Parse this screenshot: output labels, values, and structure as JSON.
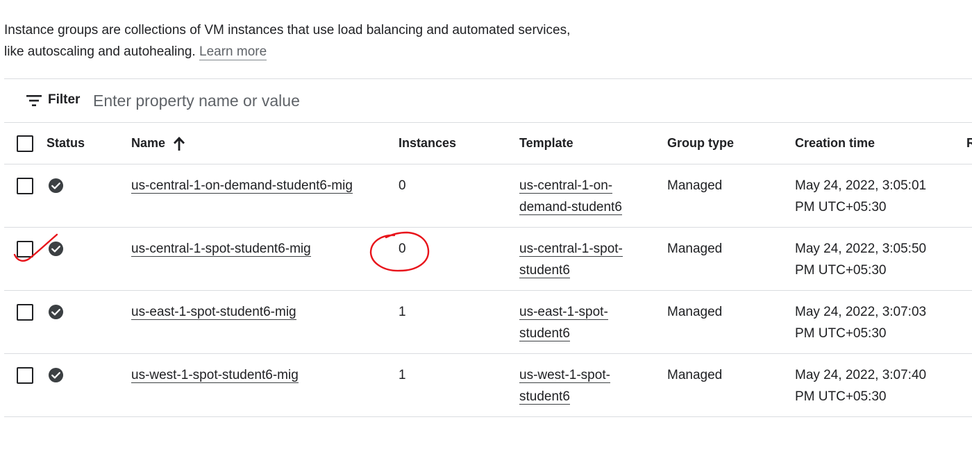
{
  "intro": {
    "text": "Instance groups are collections of VM instances that use load balancing and automated services, like autoscaling and autohealing.",
    "learn_more": "Learn more"
  },
  "filter": {
    "label": "Filter",
    "placeholder": "Enter property name or value",
    "icon": "filter-list-icon"
  },
  "table": {
    "columns": {
      "status": "Status",
      "name": "Name",
      "instances": "Instances",
      "template": "Template",
      "group_type": "Group type",
      "creation_time": "Creation time"
    },
    "sort": {
      "column": "name",
      "direction": "ascending",
      "icon": "arrow-upward-icon"
    },
    "rows": [
      {
        "status": "ok",
        "name": "us-central-1-on-demand-student6-mig",
        "instances": "0",
        "template": "us-central-1-on-demand-student6",
        "template_lines": [
          "us-central-1-on-",
          "demand-student6"
        ],
        "group_type": "Managed",
        "created_line1": "May 24, 2022, 3:05:01",
        "created_line2": "PM UTC+05:30"
      },
      {
        "status": "ok",
        "name": "us-central-1-spot-student6-mig",
        "instances": "0",
        "template": "us-central-1-spot-student6",
        "template_lines": [
          "us-central-1-spot-",
          "student6"
        ],
        "group_type": "Managed",
        "created_line1": "May 24, 2022, 3:05:50",
        "created_line2": "PM UTC+05:30"
      },
      {
        "status": "ok",
        "name": "us-east-1-spot-student6-mig",
        "instances": "1",
        "template": "us-east-1-spot-student6",
        "template_lines": [
          "us-east-1-spot-",
          "student6"
        ],
        "group_type": "Managed",
        "created_line1": "May 24, 2022, 3:07:03",
        "created_line2": "PM UTC+05:30"
      },
      {
        "status": "ok",
        "name": "us-west-1-spot-student6-mig",
        "instances": "1",
        "template": "us-west-1-spot-student6",
        "template_lines": [
          "us-west-1-spot-",
          "student6"
        ],
        "group_type": "Managed",
        "created_line1": "May 24, 2022, 3:07:40",
        "created_line2": "PM UTC+05:30"
      }
    ]
  },
  "colors": {
    "text": "#202124",
    "muted": "#5f6368",
    "divider": "#dadce0",
    "status_ok": "#3c4043",
    "annotation": "#e8141b"
  }
}
